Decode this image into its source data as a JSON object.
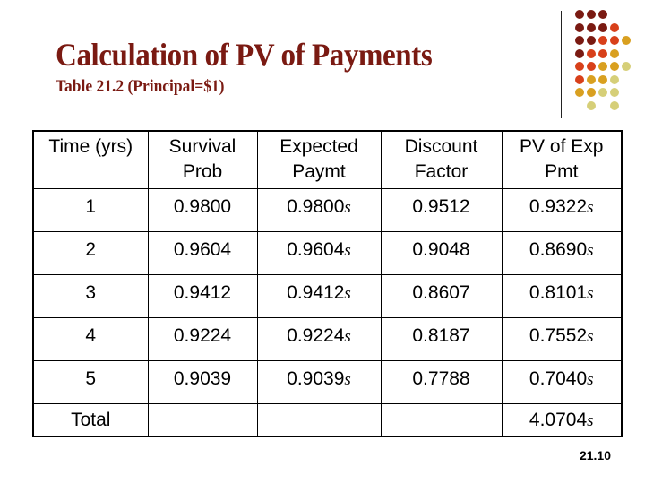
{
  "slide": {
    "title": "Calculation of PV of Payments",
    "subtitle": "Table 21.2 (Principal=$1)",
    "slide_number": "21.10",
    "accent_color": "#7a1a12",
    "decoration": {
      "icon": "dot-grid-decoration",
      "colors": [
        "#7a1a12",
        "#d8401a",
        "#d9a020",
        "#d6cf78"
      ]
    }
  },
  "table": {
    "columns": [
      {
        "line1": "Time (yrs)",
        "line2": ""
      },
      {
        "line1": "Survival",
        "line2": "Prob"
      },
      {
        "line1": "Expected",
        "line2": "Paymt"
      },
      {
        "line1": "Discount",
        "line2": "Factor"
      },
      {
        "line1": "PV of Exp",
        "line2": "Pmt"
      }
    ],
    "unit_symbol": "s",
    "rows": [
      {
        "time": "1",
        "survival": "0.9800",
        "expected": "0.9800",
        "discount": "0.9512",
        "pv": "0.9322"
      },
      {
        "time": "2",
        "survival": "0.9604",
        "expected": "0.9604",
        "discount": "0.9048",
        "pv": "0.8690"
      },
      {
        "time": "3",
        "survival": "0.9412",
        "expected": "0.9412",
        "discount": "0.8607",
        "pv": "0.8101"
      },
      {
        "time": "4",
        "survival": "0.9224",
        "expected": "0.9224",
        "discount": "0.8187",
        "pv": "0.7552"
      },
      {
        "time": "5",
        "survival": "0.9039",
        "expected": "0.9039",
        "discount": "0.7788",
        "pv": "0.7040"
      }
    ],
    "total": {
      "label": "Total",
      "pv": "4.0704"
    }
  }
}
